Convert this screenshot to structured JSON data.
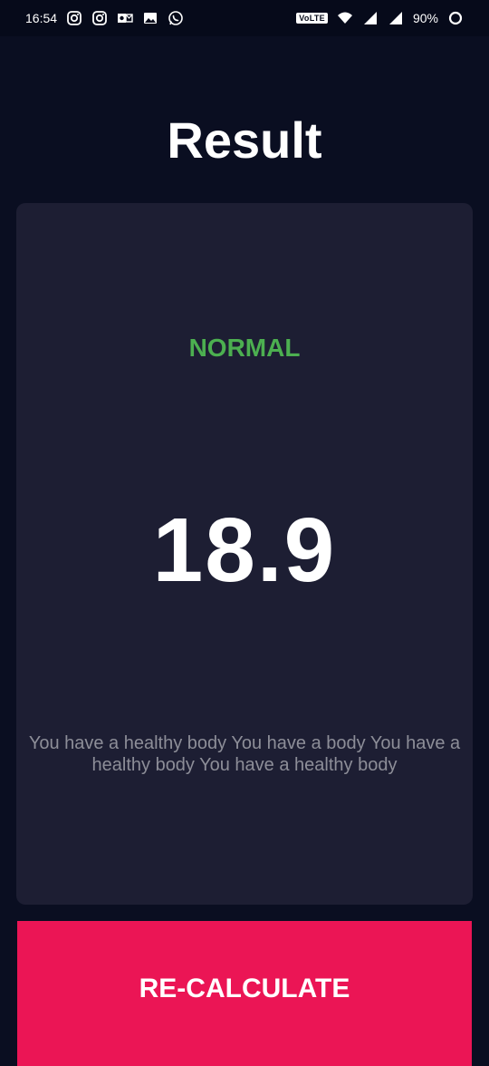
{
  "status_bar": {
    "time": "16:54",
    "left_icons": [
      "instagram-icon",
      "instagram-icon",
      "outlook-icon",
      "gallery-icon",
      "whatsapp-icon"
    ],
    "network_label": "VoLTE",
    "battery": "90%"
  },
  "page": {
    "title": "Result",
    "background_color": "#0a0e21"
  },
  "result": {
    "status": "NORMAL",
    "status_color": "#4caf50",
    "bmi": "18.9",
    "interpretation": "You have a healthy body You have a body You have a healthy body You have a healthy body",
    "card_color": "#1d1e33"
  },
  "actions": {
    "recalculate_label": "RE-CALCULATE",
    "button_color": "#eb1555"
  }
}
